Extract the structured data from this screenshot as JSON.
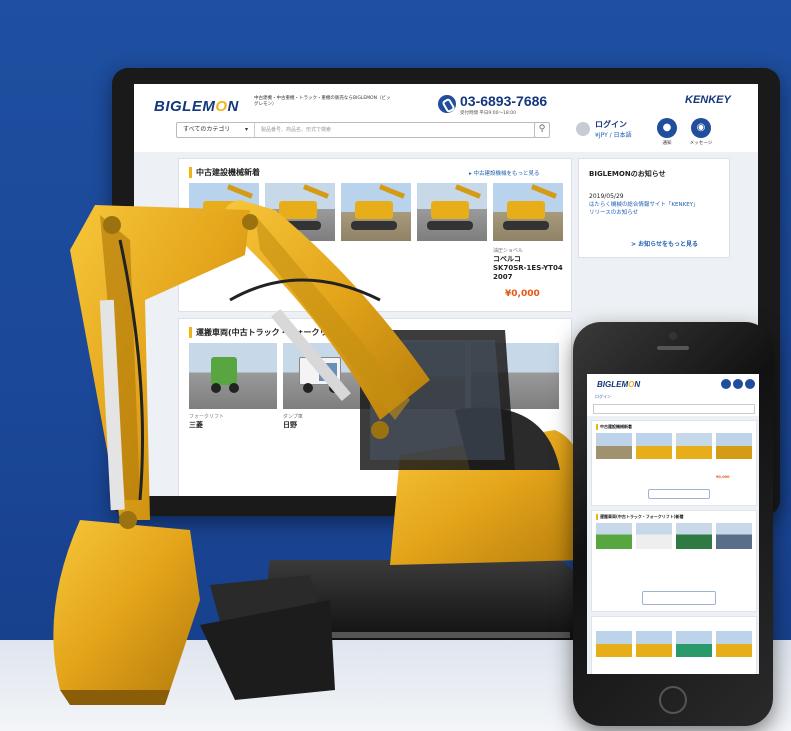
{
  "site": {
    "logo_prefix": "BIGLEM",
    "logo_o": "O",
    "logo_suffix": "N",
    "tagline": "中古建機・中古重機・トラック・重機の販売ならBIGLEMON（ビッグレモン）",
    "phone": "03-6893-7686",
    "phone_hours": "受付時間 平日9:00〜18:00",
    "partner_logo": "KENKEY"
  },
  "search": {
    "category": "すべてのカテゴリ",
    "placeholder": "製品番号、商品名、形式で検索"
  },
  "account": {
    "login": "ログイン",
    "currency_lang": "¥JPY / 日本語",
    "notice_label": "通知",
    "message_label": "メッセージ"
  },
  "section_construction": {
    "title": "中古建設機械新着",
    "more": "▸ 中古建設機械をもっと見る",
    "featured_item": {
      "category": "油圧ショベル",
      "maker": "コベルコ",
      "model": "SK70SR-1ES-YT04",
      "year": "2007",
      "price": "¥0,000"
    }
  },
  "section_transport": {
    "title": "運搬車両(中古トラック・フォークリフト)新着",
    "items": [
      {
        "category": "フォークリフト",
        "maker": "三菱"
      },
      {
        "category": "ダンプ車",
        "maker": "日野"
      }
    ]
  },
  "news": {
    "title": "BIGLEMONのお知らせ",
    "date": "2019/05/29",
    "text": "はたらく機械の総合情報サイト「KENKEY」リリースのお知らせ",
    "more": "> お知らせをもっと見る"
  },
  "icons": {
    "search": "search-icon",
    "phone": "phone-icon",
    "bell": "bell-icon",
    "message": "message-icon",
    "user": "user-icon"
  },
  "colors": {
    "brand_blue": "#15377d",
    "accent_yellow": "#f2b315",
    "price_orange": "#e85412",
    "background_blue": "#1e4fa0"
  }
}
